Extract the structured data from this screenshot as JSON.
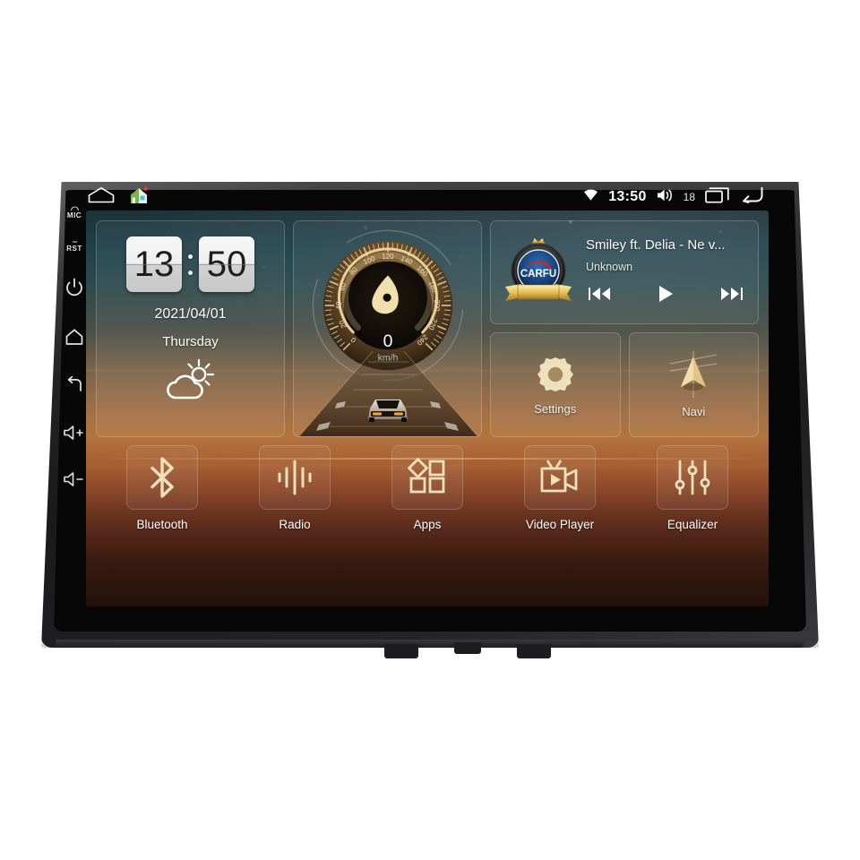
{
  "device": {
    "type": "car-head-unit",
    "hardware_keys": [
      {
        "name": "mic",
        "label": "MIC"
      },
      {
        "name": "reset",
        "label": "RST"
      },
      {
        "name": "power",
        "label": ""
      },
      {
        "name": "home",
        "label": ""
      },
      {
        "name": "back",
        "label": ""
      },
      {
        "name": "volume-up",
        "label": ""
      },
      {
        "name": "volume-down",
        "label": ""
      }
    ]
  },
  "statusbar": {
    "home_icon": "home-outline-icon",
    "app_icon": "house-app-icon",
    "wifi_icon": "wifi-icon",
    "time": "13:50",
    "volume_icon": "volume-icon",
    "volume_level": "18",
    "recents_icon": "recents-icon",
    "back_icon": "back-arrow-icon"
  },
  "clock_widget": {
    "hours": "13",
    "minutes": "50",
    "date": "2021/04/01",
    "weekday": "Thursday",
    "weather_icon": "partly-cloudy-icon"
  },
  "speed_widget": {
    "value": "0",
    "unit": "km/h",
    "ticks": [
      "0",
      "20",
      "40",
      "60",
      "80",
      "100",
      "120",
      "140",
      "160",
      "180",
      "200",
      "220",
      "240"
    ],
    "min": 0,
    "max": 240,
    "accent": "#e8cf93"
  },
  "music_widget": {
    "logo_text": "CARFU",
    "title": "Smiley ft. Delia - Ne v...",
    "artist": "Unknown",
    "prev_label": "prev-track-icon",
    "play_label": "play-icon",
    "next_label": "next-track-icon"
  },
  "shortcut_tiles": [
    {
      "name": "settings",
      "label": "Settings",
      "icon": "gear-icon"
    },
    {
      "name": "navi",
      "label": "Navi",
      "icon": "navigation-arrow-icon"
    }
  ],
  "dock_apps": [
    {
      "name": "bluetooth",
      "label": "Bluetooth",
      "icon": "bluetooth-icon"
    },
    {
      "name": "radio",
      "label": "Radio",
      "icon": "radio-waves-icon"
    },
    {
      "name": "apps",
      "label": "Apps",
      "icon": "apps-grid-icon"
    },
    {
      "name": "video-player",
      "label": "Video Player",
      "icon": "video-camera-icon"
    },
    {
      "name": "equalizer",
      "label": "Equalizer",
      "icon": "equalizer-sliders-icon"
    }
  ],
  "theme": {
    "sky_top": "#1b3339",
    "sky_bottom": "#24110a",
    "accent_gold": "#e8cf93",
    "bezel": "#1a1a1c"
  }
}
